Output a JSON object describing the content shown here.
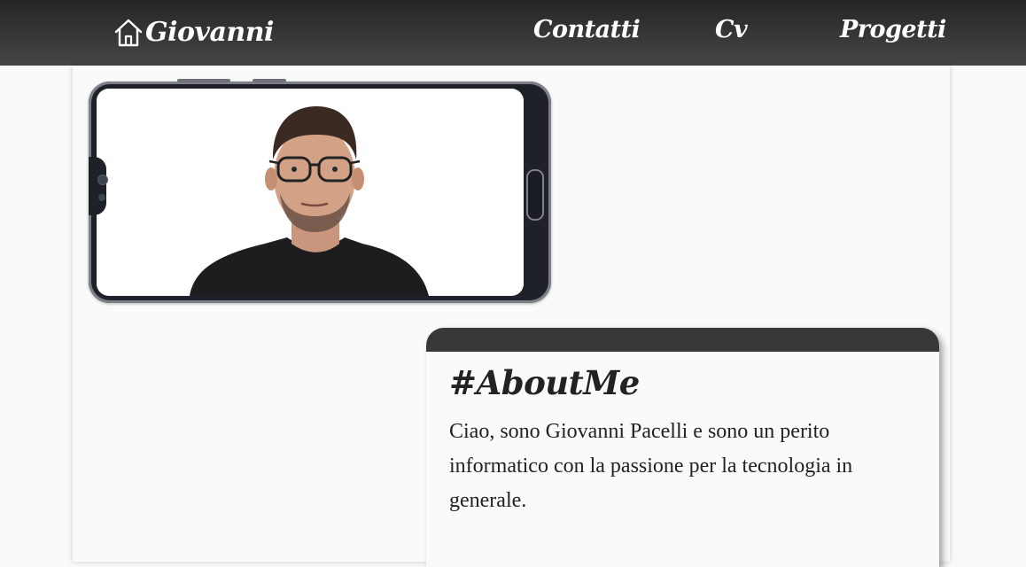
{
  "header": {
    "brand": "Giovanni",
    "brand_icon": "home-icon",
    "nav": [
      {
        "label": "Contatti"
      },
      {
        "label": "Cv"
      },
      {
        "label": "Progetti"
      }
    ]
  },
  "profile_photo": {
    "subject": "portrait inside smartphone frame"
  },
  "about": {
    "title": "#AboutMe",
    "text": "Ciao, sono Giovanni Pacelli e sono un perito informatico con la passione per la tecnologia in generale."
  },
  "colors": {
    "header_bg": "#333333",
    "card_header": "#383838",
    "page_bg": "#f9f9f9",
    "text": "#222222"
  }
}
